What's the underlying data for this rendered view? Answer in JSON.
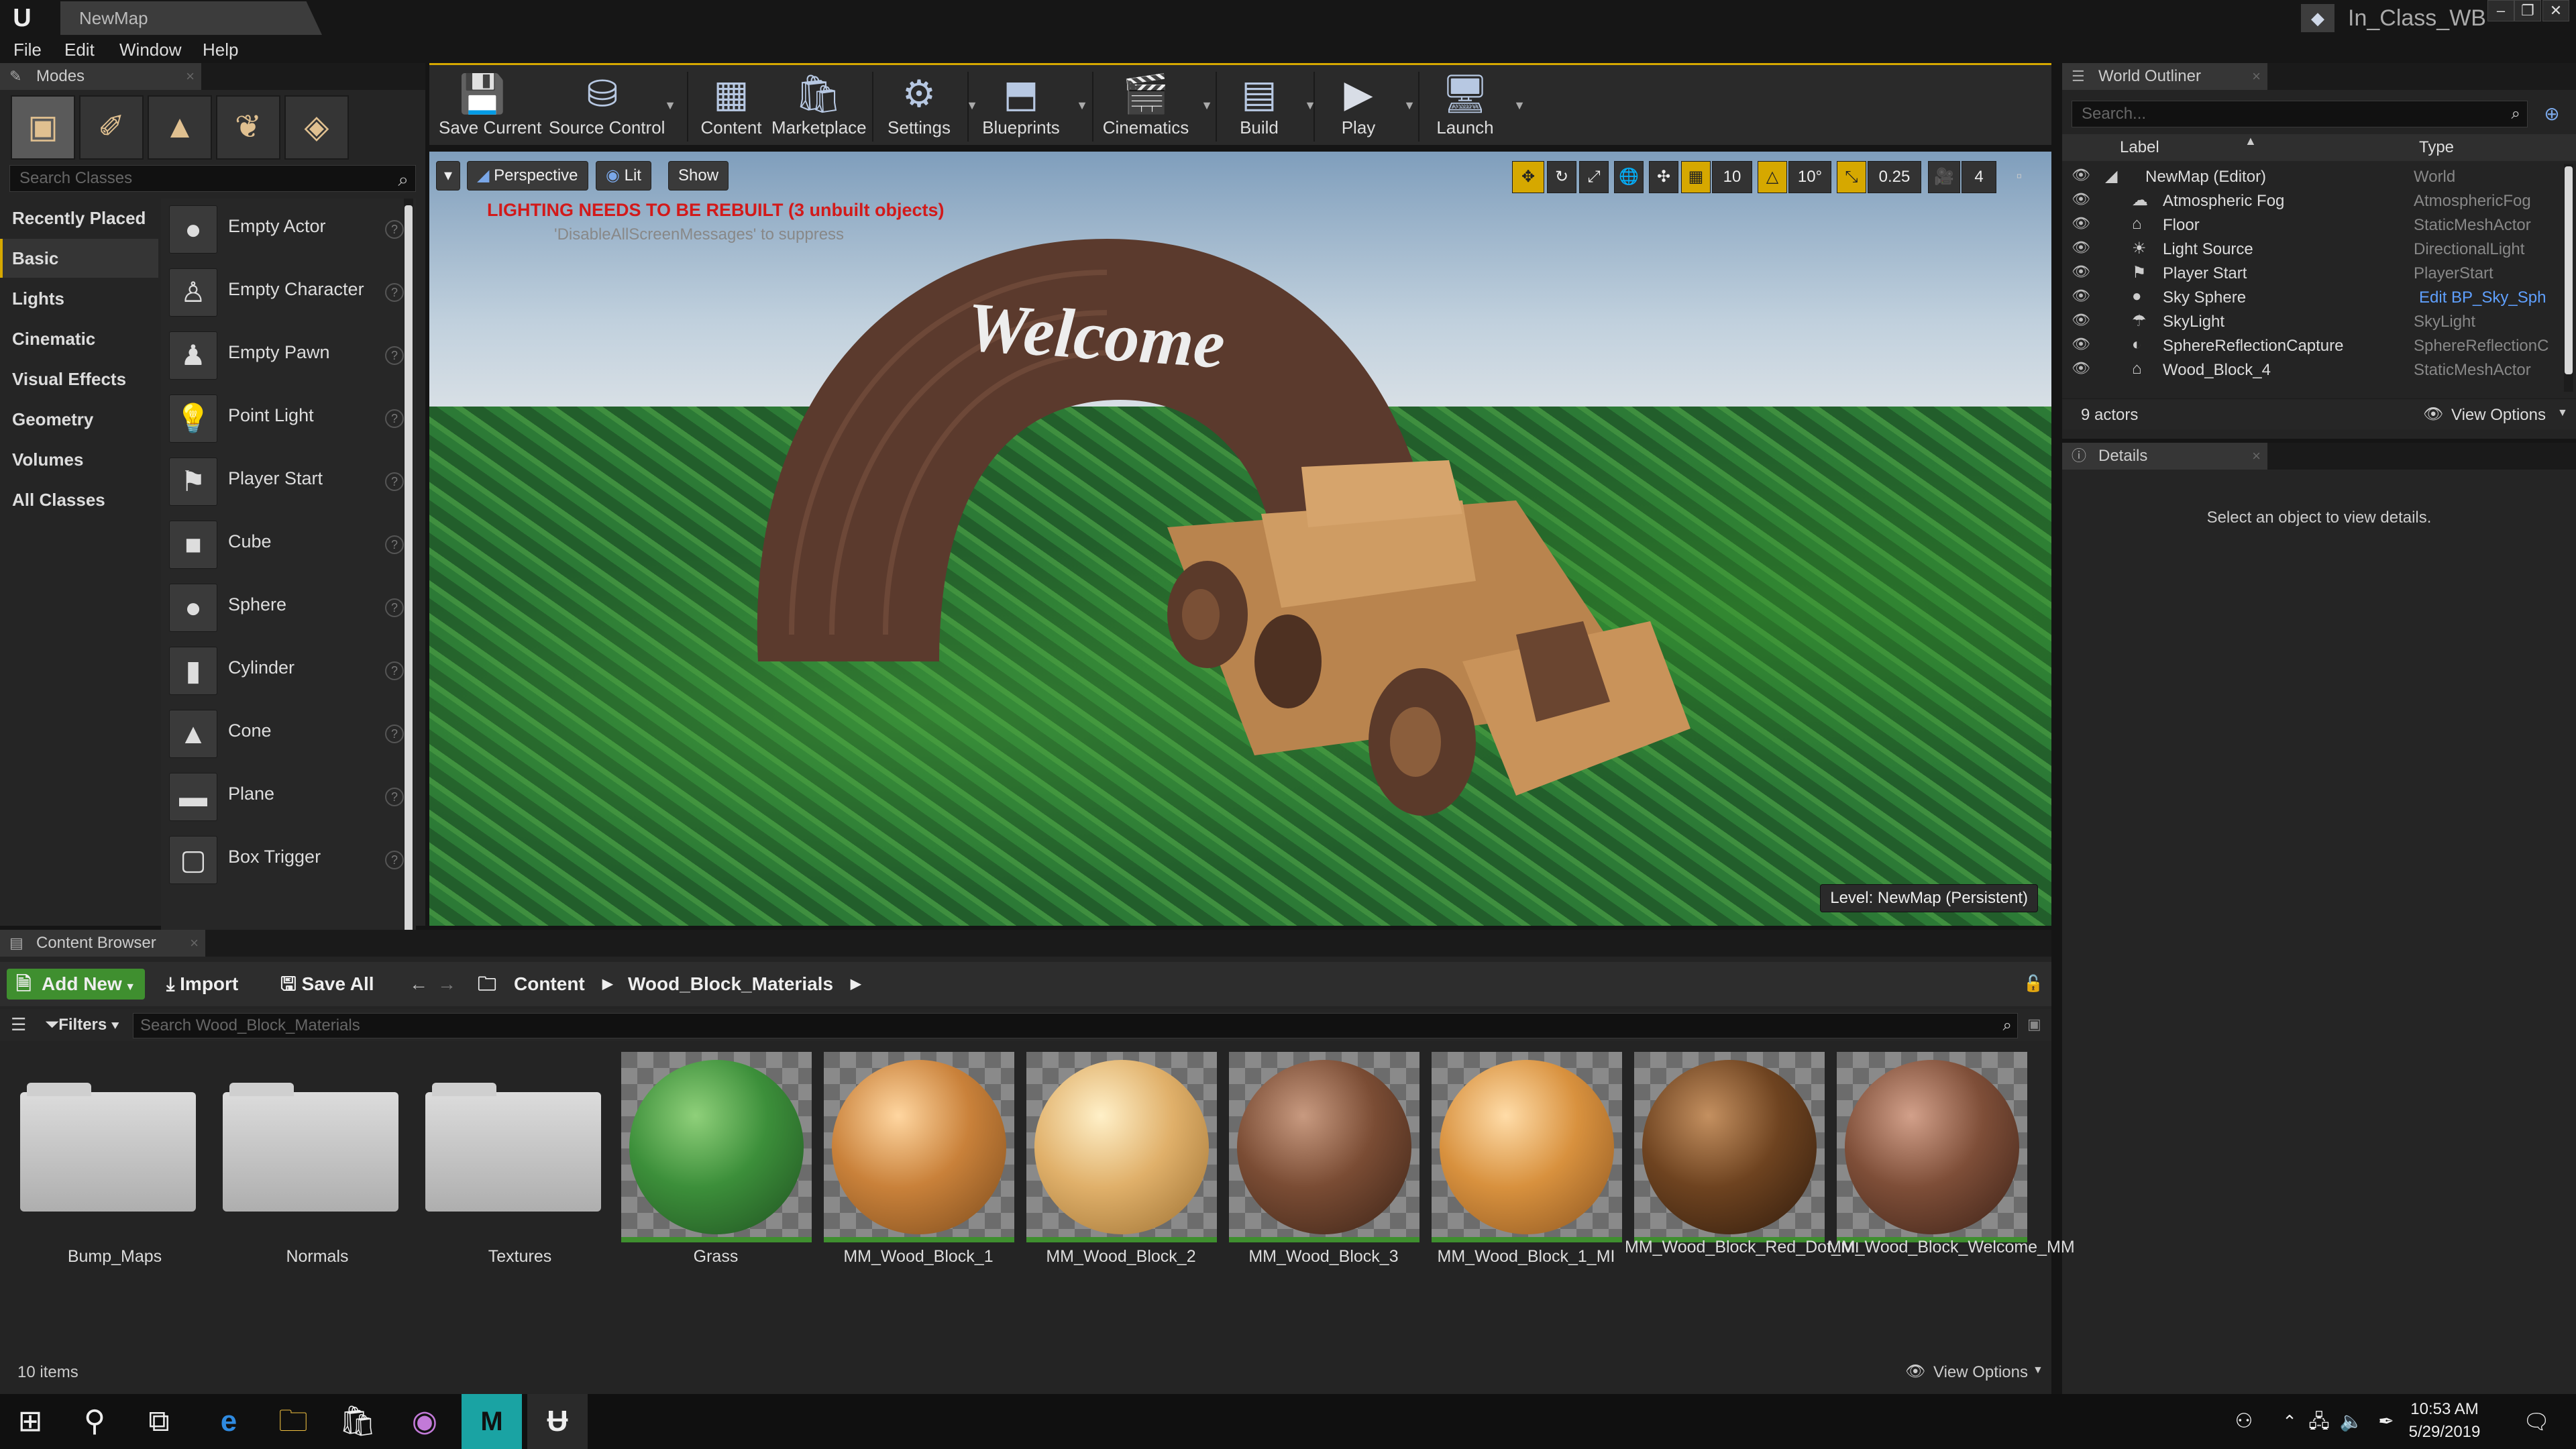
{
  "window": {
    "tab_title": "NewMap",
    "project": "In_Class_WB"
  },
  "menu": [
    "File",
    "Edit",
    "Window",
    "Help"
  ],
  "modes": {
    "tab": "Modes",
    "search_placeholder": "Search Classes",
    "categories": [
      "Recently Placed",
      "Basic",
      "Lights",
      "Cinematic",
      "Visual Effects",
      "Geometry",
      "Volumes",
      "All Classes"
    ],
    "active_category": "Basic",
    "classes": [
      "Empty Actor",
      "Empty Character",
      "Empty Pawn",
      "Point Light",
      "Player Start",
      "Cube",
      "Sphere",
      "Cylinder",
      "Cone",
      "Plane",
      "Box Trigger"
    ]
  },
  "toolbar": {
    "buttons": [
      "Save Current",
      "Source Control",
      "Content",
      "Marketplace",
      "Settings",
      "Blueprints",
      "Cinematics",
      "Build",
      "Play",
      "Launch"
    ]
  },
  "viewport": {
    "perspective": "Perspective",
    "lit": "Lit",
    "show": "Show",
    "warning": "LIGHTING NEEDS TO BE REBUILT (3 unbuilt objects)",
    "suppress": "'DisableAllScreenMessages' to suppress",
    "level_label": "Level:  NewMap (Persistent)",
    "arch_text": "Welcome",
    "snap_grid": "10",
    "snap_rotation": "10°",
    "snap_scale": "0.25",
    "camera_speed": "4"
  },
  "outliner": {
    "tab": "World Outliner",
    "search_placeholder": "Search...",
    "col_label": "Label",
    "col_type": "Type",
    "rows": [
      {
        "name": "NewMap (Editor)",
        "type": "World"
      },
      {
        "name": "Atmospheric Fog",
        "type": "AtmosphericFog"
      },
      {
        "name": "Floor",
        "type": "StaticMeshActor"
      },
      {
        "name": "Light Source",
        "type": "DirectionalLight"
      },
      {
        "name": "Player Start",
        "type": "PlayerStart"
      },
      {
        "name": "Sky Sphere",
        "type": "Edit BP_Sky_Sph"
      },
      {
        "name": "SkyLight",
        "type": "SkyLight"
      },
      {
        "name": "SphereReflectionCapture",
        "type": "SphereReflectionC"
      },
      {
        "name": "Wood_Block_4",
        "type": "StaticMeshActor"
      }
    ],
    "actor_count": "9 actors",
    "view_options": "View Options"
  },
  "details": {
    "tab": "Details",
    "empty_message": "Select an object to view details."
  },
  "content_browser": {
    "tab": "Content Browser",
    "add_new": "Add New",
    "import": "Import",
    "save_all": "Save All",
    "path_root": "Content",
    "path_folder": "Wood_Block_Materials",
    "filters": "Filters",
    "search_placeholder": "Search Wood_Block_Materials",
    "assets": [
      {
        "name": "Bump_Maps",
        "kind": "folder"
      },
      {
        "name": "Normals",
        "kind": "folder"
      },
      {
        "name": "Textures",
        "kind": "folder"
      },
      {
        "name": "Grass",
        "kind": "material",
        "color": "#3c8f3a"
      },
      {
        "name": "MM_Wood_Block_1",
        "kind": "material",
        "color": "#c9813a"
      },
      {
        "name": "MM_Wood_Block_2",
        "kind": "material",
        "color": "#e0b06a"
      },
      {
        "name": "MM_Wood_Block_3",
        "kind": "material",
        "color": "#7a4c34"
      },
      {
        "name": "MM_Wood_Block_1_MI",
        "kind": "material",
        "color": "#d8913e"
      },
      {
        "name": "MM_Wood_Block_Red_Dot_MI",
        "kind": "material",
        "color": "#6e4320"
      },
      {
        "name": "MM_Wood_Block_Welcome_MM",
        "kind": "material",
        "color": "#7e4e38"
      }
    ],
    "item_count": "10 items",
    "view_options": "View Options"
  },
  "taskbar": {
    "time": "10:53 AM",
    "date": "5/29/2019"
  },
  "colors": {
    "accent": "#d6a800",
    "add_new": "#3f8f2f",
    "warning": "#d21a1a"
  }
}
